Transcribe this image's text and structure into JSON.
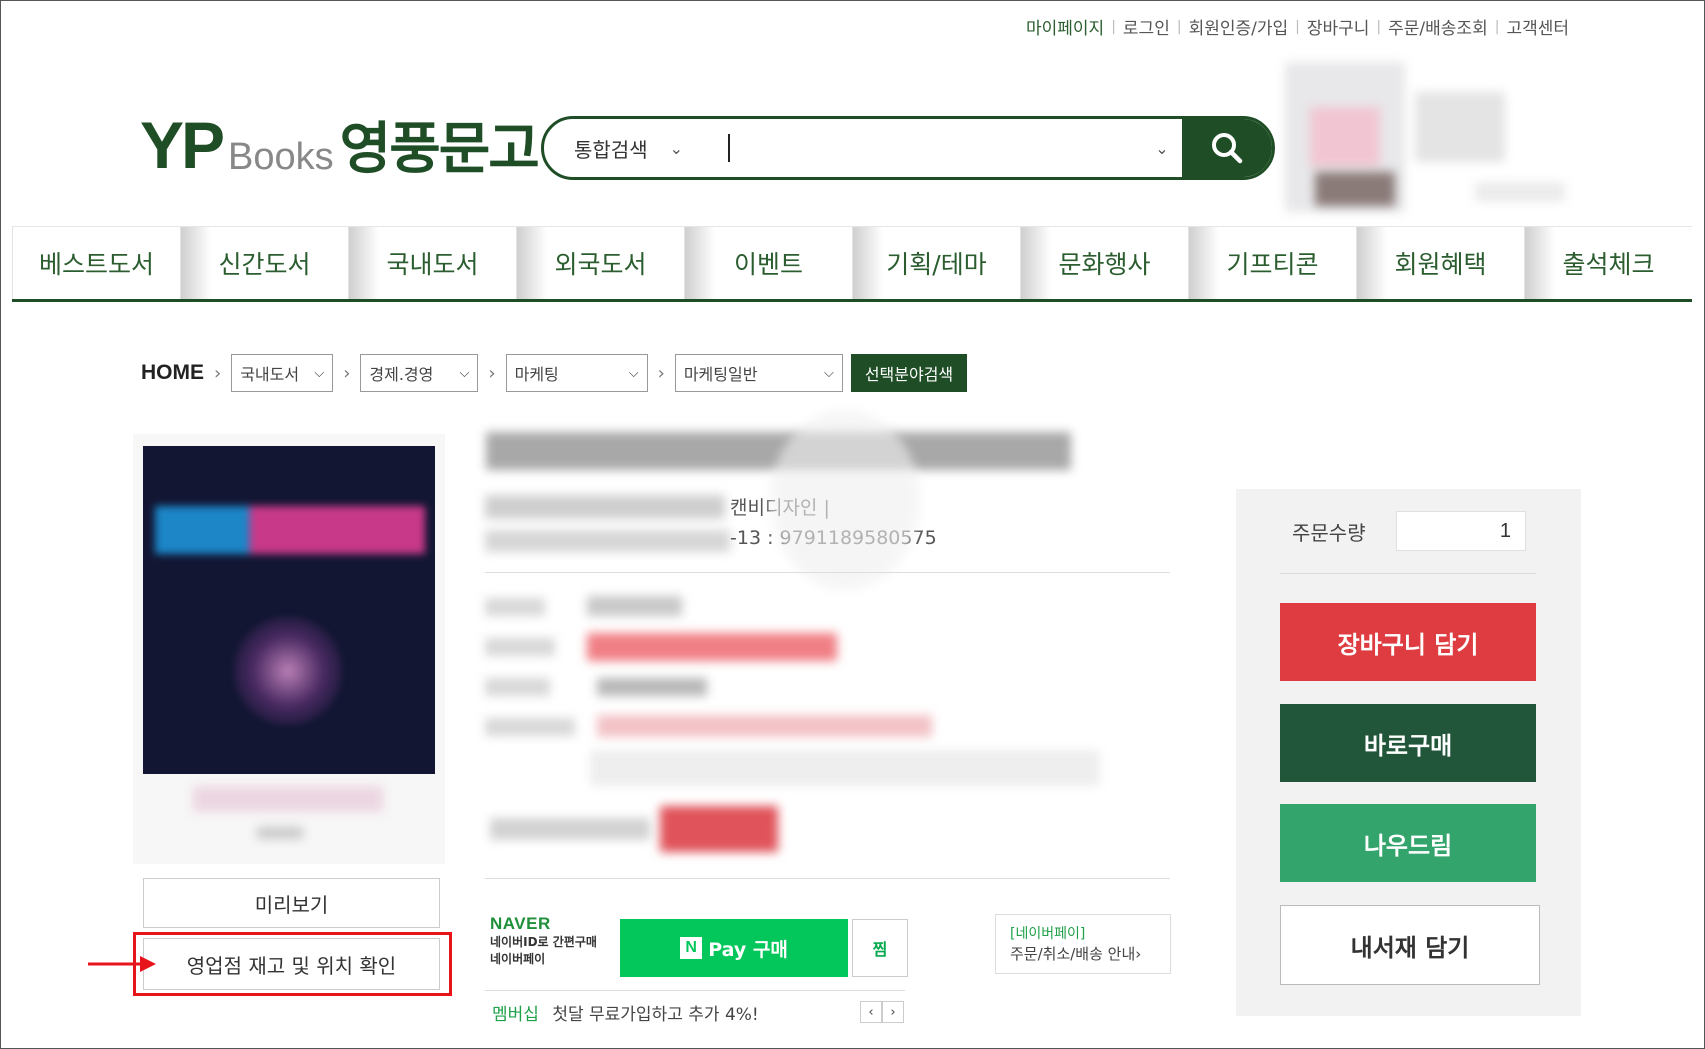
{
  "top_links": [
    "마이페이지",
    "로그인",
    "회원인증/가입",
    "장바구니",
    "주문/배송조회",
    "고객센터"
  ],
  "logo": {
    "yp": "YP",
    "books": "Books",
    "korean": "영풍문고"
  },
  "search": {
    "scope": "통합검색",
    "value": "",
    "button_icon": "search-icon"
  },
  "nav": [
    "베스트도서",
    "신간도서",
    "국내도서",
    "외국도서",
    "이벤트",
    "기획/테마",
    "문화행사",
    "기프티콘",
    "회원혜택",
    "출석체크"
  ],
  "breadcrumb": {
    "home": "HOME",
    "levels": [
      "국내도서",
      "경제.경영",
      "마케팅",
      "마케팅일반"
    ],
    "search_button": "선택분야검색"
  },
  "product": {
    "publisher_fragment": "캔비디자인 |",
    "isbn_fragment": "-13 : 9791189580575"
  },
  "actions": {
    "preview": "미리보기",
    "stock_check": "영업점 재고 및 위치 확인"
  },
  "naver_pay": {
    "brand": "NAVER",
    "line1": "네이버ID로 간편구매",
    "line2": "네이버페이",
    "n_mark": "N",
    "pay_button": "Pay 구매",
    "wish": "찜",
    "info_tag": "[네이버페이]",
    "info_text": "주문/취소/배송 안내›",
    "membership_tag": "멤버십",
    "membership_text": "첫달 무료가입하고 추가 4%!"
  },
  "order": {
    "qty_label": "주문수량",
    "qty_value": "1",
    "cart": "장바구니 담기",
    "buy_now": "바로구매",
    "nowdream": "나우드림",
    "my_shelf": "내서재 담기"
  },
  "colors": {
    "brand_green": "#1f4e26",
    "cart_red": "#de3c41",
    "buy_green": "#22563a",
    "nowdream_green": "#33a46c",
    "naver_green": "#03c75a",
    "highlight_red": "#e8141c"
  }
}
